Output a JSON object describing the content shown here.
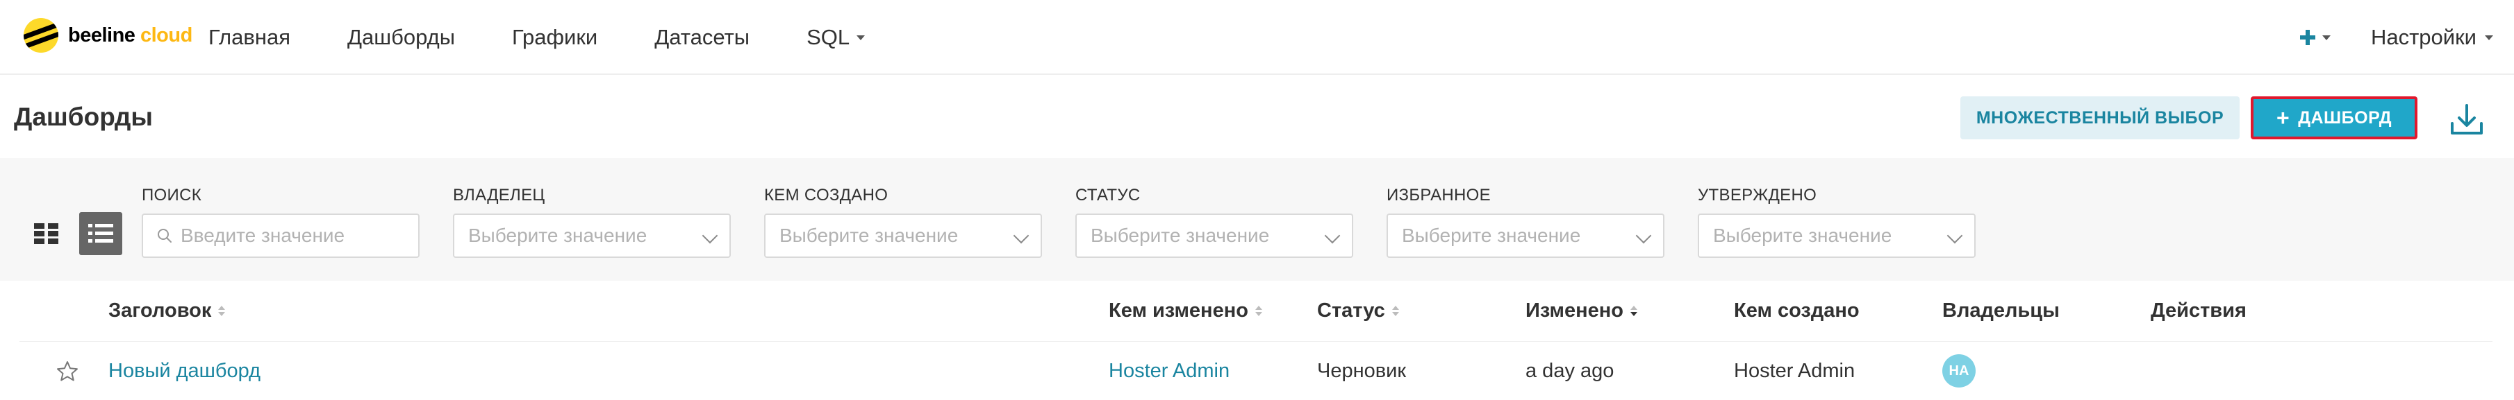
{
  "brand": {
    "name_part1": "beeline",
    "name_part2": "cloud",
    "logo_icon": "beeline-logo-icon"
  },
  "nav": {
    "items": [
      "Главная",
      "Дашборды",
      "Графики",
      "Датасеты"
    ],
    "sql_label": "SQL",
    "add_icon": "plus-icon",
    "settings_label": "Настройки"
  },
  "header": {
    "title": "Дашборды",
    "multi_select_label": "МНОЖЕСТВЕННЫЙ ВЫБОР",
    "add_dashboard_label": "ДАШБОРД",
    "add_dashboard_icon": "+",
    "download_icon": "download-icon"
  },
  "filters": {
    "search": {
      "label": "ПОИСК",
      "placeholder": "Введите значение"
    },
    "owner": {
      "label": "ВЛАДЕЛЕЦ",
      "placeholder": "Выберите значение"
    },
    "created_by": {
      "label": "КЕМ СОЗДАНО",
      "placeholder": "Выберите значение"
    },
    "status": {
      "label": "СТАТУС",
      "placeholder": "Выберите значение"
    },
    "favorite": {
      "label": "ИЗБРАННОЕ",
      "placeholder": "Выберите значение"
    },
    "approved": {
      "label": "УТВЕРЖДЕНО",
      "placeholder": "Выберите значение"
    },
    "view_modes": [
      "grid-view-icon",
      "list-view-icon"
    ],
    "active_view": "list"
  },
  "table": {
    "columns": {
      "title": "Заголовок",
      "modified_by": "Кем изменено",
      "status": "Статус",
      "modified": "Изменено",
      "created_by": "Кем создано",
      "owners": "Владельцы",
      "actions": "Действия"
    },
    "sorted_column": "modified",
    "rows": [
      {
        "favorite": false,
        "title": "Новый дашборд",
        "modified_by": "Hoster Admin",
        "status": "Черновик",
        "modified": "a day ago",
        "created_by": "Hoster Admin",
        "owner_initials": "HA"
      }
    ]
  },
  "colors": {
    "accent": "#20a7c9",
    "link": "#1a85a0",
    "highlight_border": "#e0182d",
    "brand_yellow": "#fdd92a"
  }
}
